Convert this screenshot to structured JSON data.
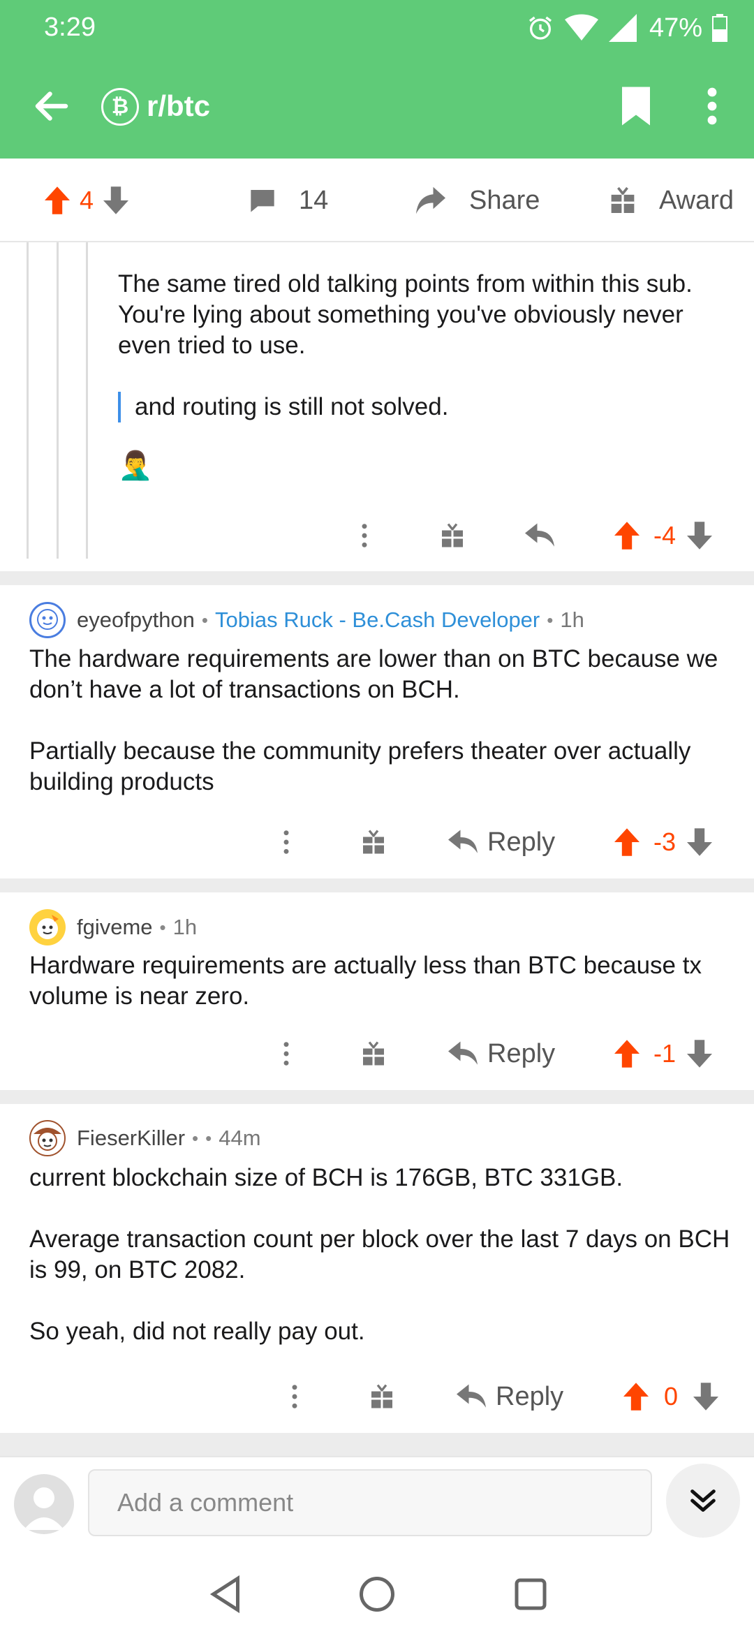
{
  "status_bar": {
    "time": "3:29",
    "battery": "47%"
  },
  "app_bar": {
    "subreddit": "r/btc",
    "sub_icon_glyph": "₿"
  },
  "post_bar": {
    "score": "4",
    "comments": "14",
    "share_label": "Share",
    "award_label": "Award"
  },
  "comments": [
    {
      "body": [
        "The same tired old talking points from within this sub. You're lying about something you've obviously never even tried to use."
      ],
      "quote": "and routing is still not solved.",
      "emoji": "🤦‍♂️",
      "score": "-4"
    },
    {
      "author": "eyeofpython",
      "flair": "Tobias Ruck - Be.Cash Developer",
      "age": "1h",
      "body": [
        "The hardware requirements are lower than on BTC because we don’t have a lot of transactions on BCH.",
        "Partially because the community prefers theater over actually building products"
      ],
      "reply_label": "Reply",
      "score": "-3"
    },
    {
      "author": "fgiveme",
      "age": "1h",
      "body": [
        "Hardware requirements are actually less than BTC because tx volume is near zero."
      ],
      "reply_label": "Reply",
      "score": "-1"
    },
    {
      "author": "FieserKiller",
      "age": "44m",
      "body": [
        "current blockchain size of BCH is 176GB, BTC 331GB.",
        "Average transaction count per block over the last 7 days on BCH is 99, on BTC 2082.",
        "So yeah, did not really pay out."
      ],
      "reply_label": "Reply",
      "score": "0"
    }
  ],
  "composer": {
    "placeholder": "Add a comment"
  },
  "colors": {
    "app_bar": "#5fcb78",
    "upvote": "#ff4500",
    "flair": "#2e8fd8",
    "quote_bar": "#3d8fe8"
  },
  "icons": [
    "back-arrow-icon",
    "bitcoin-icon",
    "bookmark-icon",
    "overflow-menu-icon",
    "upvote-icon",
    "downvote-icon",
    "comment-icon",
    "share-icon",
    "award-icon",
    "more-vert-icon",
    "reply-icon",
    "double-chevron-down-icon",
    "nav-back-icon",
    "nav-home-icon",
    "nav-recents-icon"
  ]
}
